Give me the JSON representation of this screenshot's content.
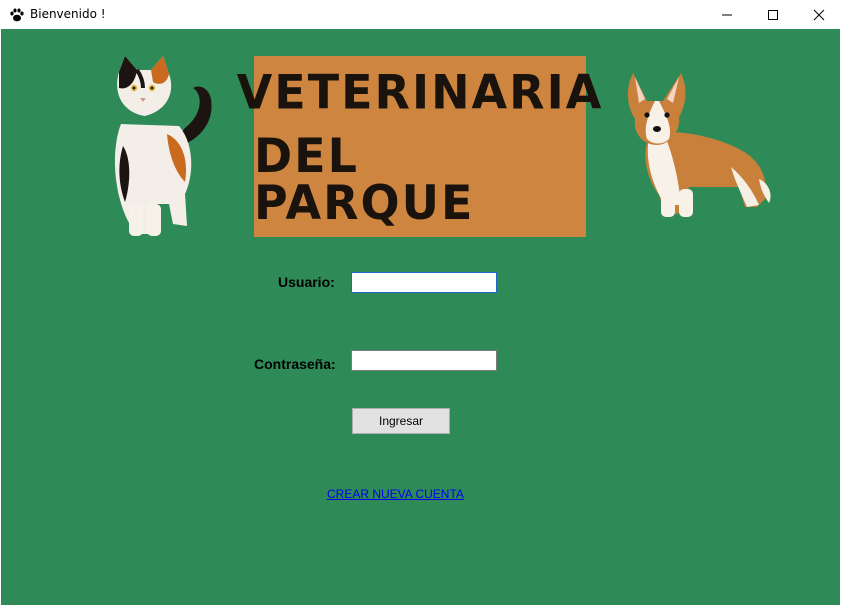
{
  "window": {
    "title": "Bienvenido !",
    "icon": "paw-icon"
  },
  "banner": {
    "line1": "VETERINARIA",
    "line2": "DEL PARQUE",
    "background": "#cd853f"
  },
  "form": {
    "username_label": "Usuario:",
    "username_value": "",
    "password_label": "Contraseña:",
    "password_value": "",
    "login_button": "Ingresar",
    "create_account_link": "CREAR NUEVA CUENTA"
  },
  "colors": {
    "background": "#2e8b57",
    "link": "#0000ee"
  }
}
